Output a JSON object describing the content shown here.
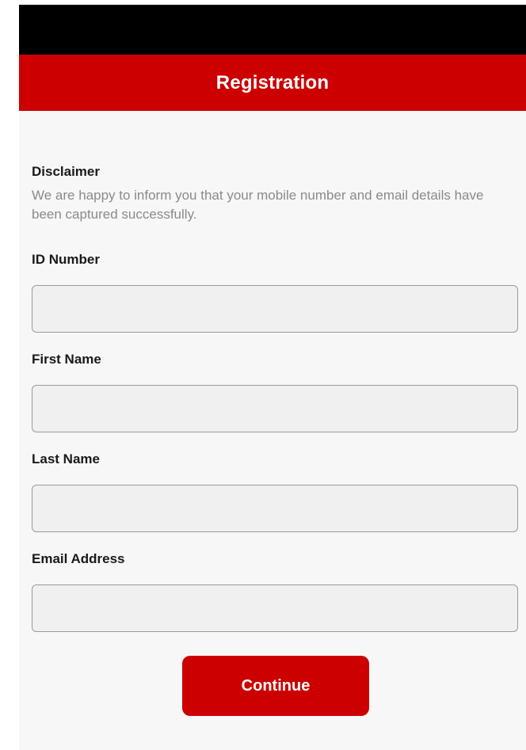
{
  "app_bar": {
    "title": "Registration"
  },
  "disclaimer": {
    "title": "Disclaimer",
    "text": "We are happy to inform you that your mobile number and email details have been captured successfully."
  },
  "form": {
    "id_number": {
      "label": "ID Number",
      "value": ""
    },
    "first_name": {
      "label": "First Name",
      "value": ""
    },
    "last_name": {
      "label": "Last Name",
      "value": ""
    },
    "email": {
      "label": "Email Address",
      "value": ""
    }
  },
  "actions": {
    "continue_label": "Continue"
  },
  "colors": {
    "brand": "#cc0000",
    "status_bar": "#000000",
    "background": "#f7f7f7",
    "input_fill": "#f0f0f0"
  }
}
